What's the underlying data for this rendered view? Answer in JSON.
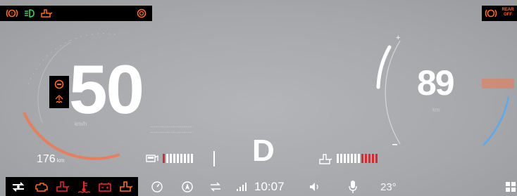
{
  "speed": {
    "value": "50",
    "unit": "km/h"
  },
  "gauge": {
    "value": "89",
    "unit": "km"
  },
  "range": {
    "value": "176",
    "unit": "km"
  },
  "gear": "D",
  "status_bar": {
    "time": "10:07",
    "temperature": "23°"
  },
  "rear_indicator": {
    "line1": "REAR",
    "line2": "OFF"
  },
  "fuel_bar": {
    "segments_red": 1,
    "segments_white": 8
  },
  "heat_bar": {
    "segments_white": 7,
    "segments_red": 5
  },
  "colors": {
    "warning_orange": "#ff6a1a",
    "red": "#e8242a",
    "green": "#2ad35a",
    "speed_arc": "#f07850",
    "power_arc_blue": "#5aaaf0"
  },
  "icons": {
    "top_left": [
      "brake-warning-icon",
      "fog-light-icon",
      "oil-can-icon"
    ],
    "top_left_extra": "hazard-ring-icon",
    "top_right": "brake-pad-icon",
    "speed_side": [
      "stop-sign-icon",
      "traction-control-icon"
    ],
    "bottom_left": [
      "transfer-arrows-icon",
      "engine-check-icon",
      "oil-pressure-icon",
      "coolant-temperature-icon",
      "battery-icon",
      "oil-level-icon"
    ],
    "status_bar": [
      "gauge-icon",
      "navigation-icon",
      "media-icon",
      "signal-icon",
      "volume-icon",
      "microphone-icon",
      "apps-grid-icon"
    ]
  }
}
